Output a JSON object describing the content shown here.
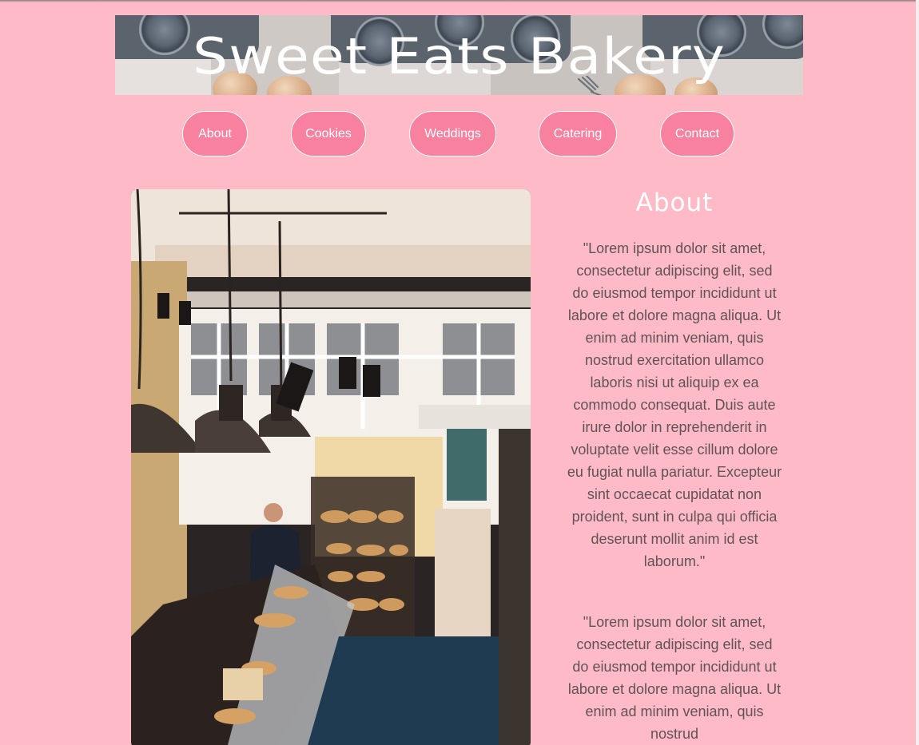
{
  "site": {
    "title": "Sweet Eats Bakery"
  },
  "nav": {
    "items": [
      {
        "label": "About"
      },
      {
        "label": "Cookies"
      },
      {
        "label": "Weddings"
      },
      {
        "label": "Catering"
      },
      {
        "label": "Contact"
      }
    ]
  },
  "about": {
    "heading": "About",
    "paragraphs": [
      "\"Lorem ipsum dolor sit amet, consectetur adipiscing elit, sed do eiusmod tempor incididunt ut labore et dolore magna aliqua. Ut enim ad minim veniam, quis nostrud exercitation ullamco laboris nisi ut aliquip ex ea commodo consequat. Duis aute irure dolor in reprehenderit in voluptate velit esse cillum dolore eu fugiat nulla pariatur. Excepteur sint occaecat cupidatat non proident, sunt in culpa qui officia deserunt mollit anim id est laborum.\"",
      "\"Lorem ipsum dolor sit amet, consectetur adipiscing elit, sed do eiusmod tempor incididunt ut labore et dolore magna aliqua. Ut enim ad minim veniam, quis nostrud"
    ]
  },
  "colors": {
    "page_background": "#ffbac8",
    "nav_button": "#f7819f",
    "heading_text": "#ffffff",
    "body_text": "#5e5456"
  },
  "icons": {
    "fork": "fork-icon"
  }
}
